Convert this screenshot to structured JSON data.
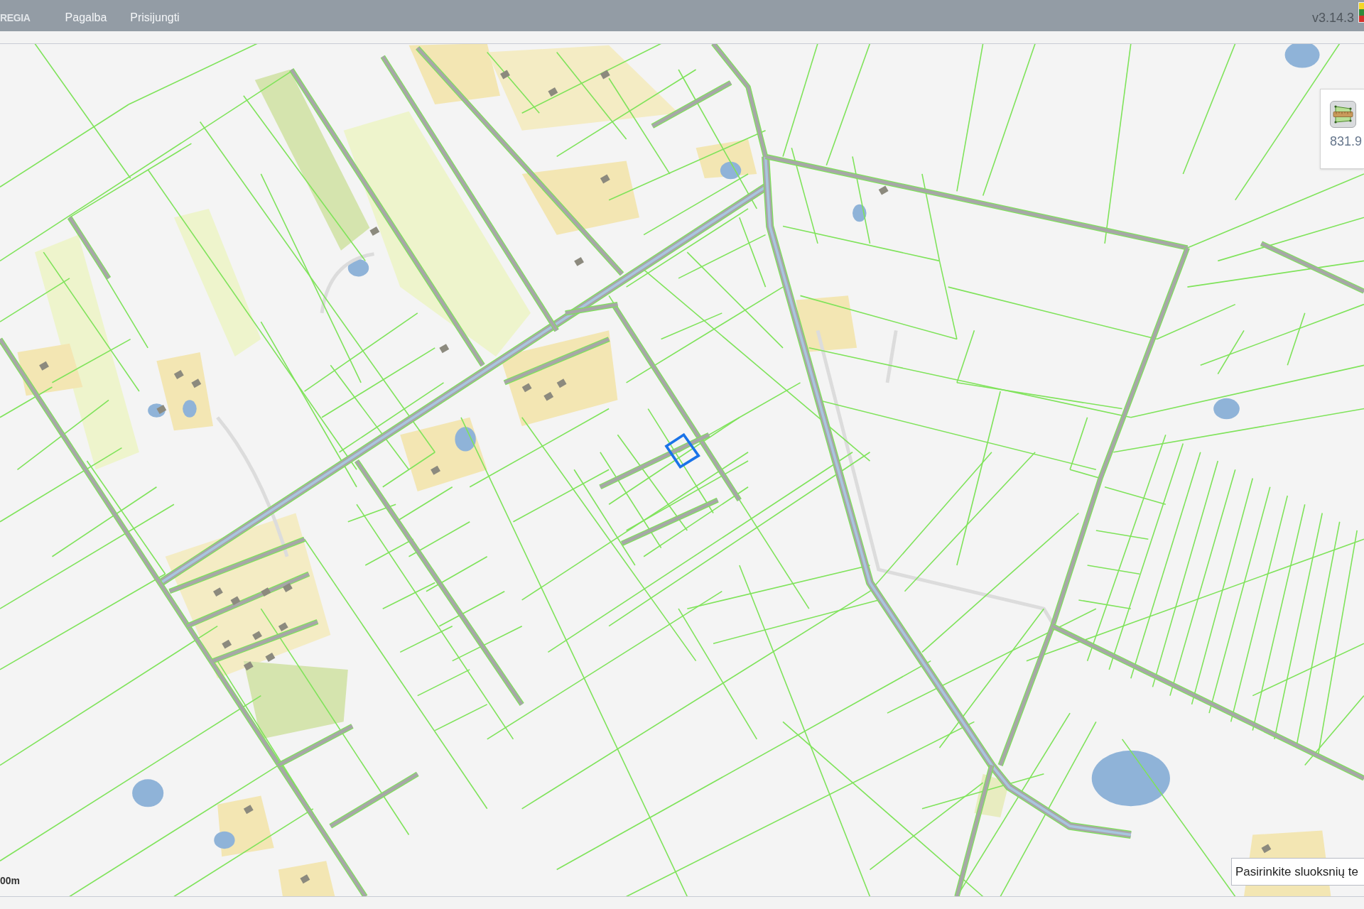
{
  "top_bar": {
    "brand": "REGIA",
    "menu": [
      {
        "label": "Pagalba"
      },
      {
        "label": "Prisijungti"
      }
    ],
    "version": "v3.14.3"
  },
  "measure_panel": {
    "value": "831.9"
  },
  "scale_bar": {
    "label": "00m"
  },
  "layer_hint": {
    "text": "Pasirinkite sluoksnių te"
  }
}
